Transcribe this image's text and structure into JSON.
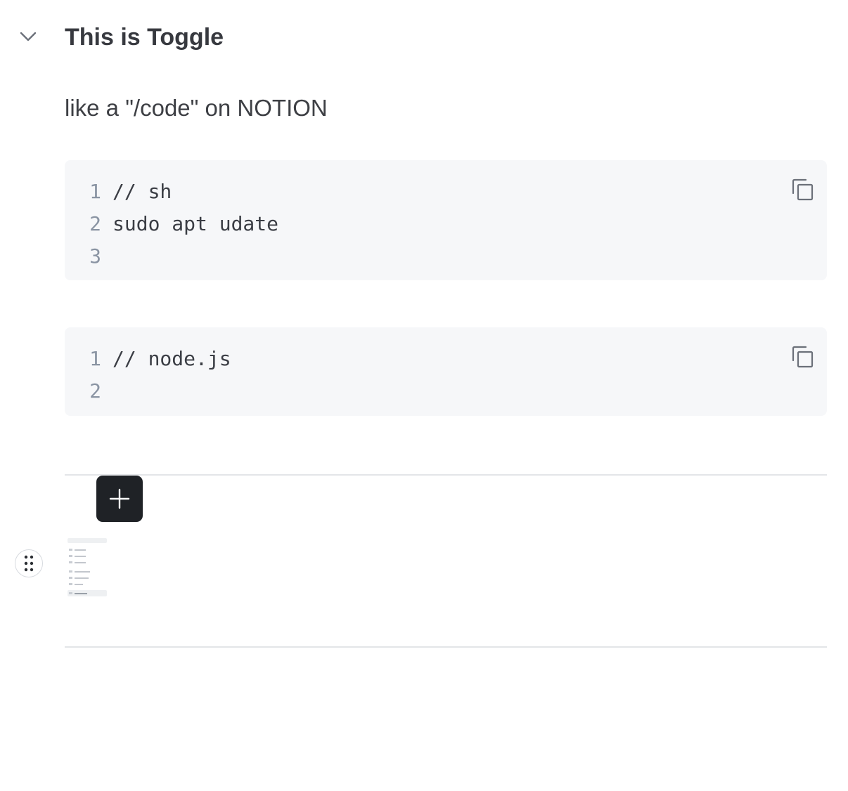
{
  "toggle": {
    "title": "This is Toggle",
    "chevron_icon": "chevron-down-icon"
  },
  "paragraph": {
    "text": "like a \"/code\" on NOTION"
  },
  "code_blocks": [
    {
      "lines": [
        {
          "num": "1",
          "text": "// sh"
        },
        {
          "num": "2",
          "text": "sudo apt udate"
        },
        {
          "num": "3",
          "text": ""
        }
      ],
      "copy_icon": "copy-icon"
    },
    {
      "lines": [
        {
          "num": "1",
          "text": "// node.js"
        },
        {
          "num": "2",
          "text": ""
        }
      ],
      "copy_icon": "copy-icon"
    }
  ],
  "block_controls": {
    "add_icon": "plus-icon",
    "drag_icon": "drag-handle-icon"
  },
  "colors": {
    "code_background": "#f6f7f9",
    "add_button_background": "#1f2226",
    "line_number": "#8a94a3",
    "divider": "#e3e5e8"
  }
}
